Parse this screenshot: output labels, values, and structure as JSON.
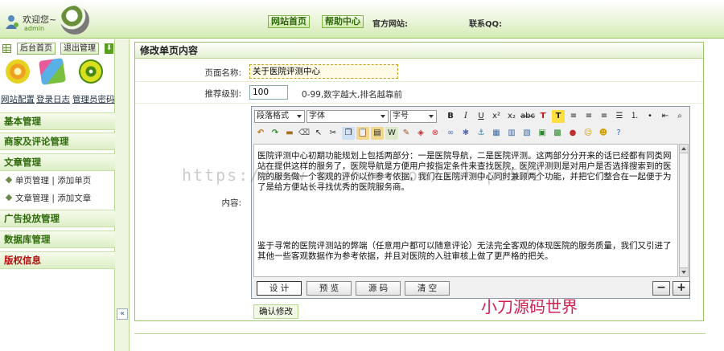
{
  "header": {
    "welcome": "欢迎您~",
    "admin_name": "admin",
    "nav_home": "网站首页",
    "nav_help": "帮助中心",
    "site_label": "官方网站:",
    "qq_label": "联系QQ:"
  },
  "sidebar": {
    "home_btn": "后台首页",
    "logout_btn": "退出管理",
    "tools": {
      "config": "网站配置",
      "log": "登录日志",
      "password": "管理员密码"
    },
    "sections": {
      "basic": "基本管理",
      "merchant": "商家及评论管理",
      "article": "文章管理",
      "ads": "广告投放管理",
      "db": "数据库管理",
      "copyright": "版权信息"
    },
    "sub_single": "单页管理 | 添加单页",
    "sub_article": "文章管理 | 添加文章",
    "collapse": "«"
  },
  "main": {
    "title": "修改单页内容",
    "name_label": "页面名称:",
    "name_value": "关于医院评测中心",
    "level_label": "推荐级别:",
    "level_value": "100",
    "level_hint": "0-99,数字越大,排名越靠前",
    "content_label": "内容:",
    "confirm_btn": "确认修改"
  },
  "editor": {
    "paragraph_select": "段落格式",
    "font_select": "字体",
    "size_select": "字号",
    "text_p1": "医院评测中心初期功能规划上包括两部分：一是医院导航，二是医院评测。这两部分分开来的话已经都有同类网站在提供这样的服务了，医院导航是方便用户按指定条件来查找医院，医院评测则是对用户是否选择搜索到的医院的服务做一个客观的评价以作参考依据，我们在医院评测中心同时兼顾两个功能，并把它们整合在一起便于为了是给方便站长寻找优秀的医院服务商。",
    "text_p2": "鉴于寻常的医院评测站的弊端（任意用户都可以随意评论）无法完全客观的体现医院的服务质量，我们又引进了其他一些客观数据作为参考依据，并且对医院的入驻审核上做了更严格的把关。",
    "mode_design": "设 计",
    "mode_preview": "预 览",
    "mode_source": "源 码",
    "mode_clear": "清 空",
    "shrink": "−",
    "grow": "+"
  },
  "watermark": {
    "url": "https://www.huzhan.com/ishop3572",
    "brand": "小刀源码世界"
  }
}
